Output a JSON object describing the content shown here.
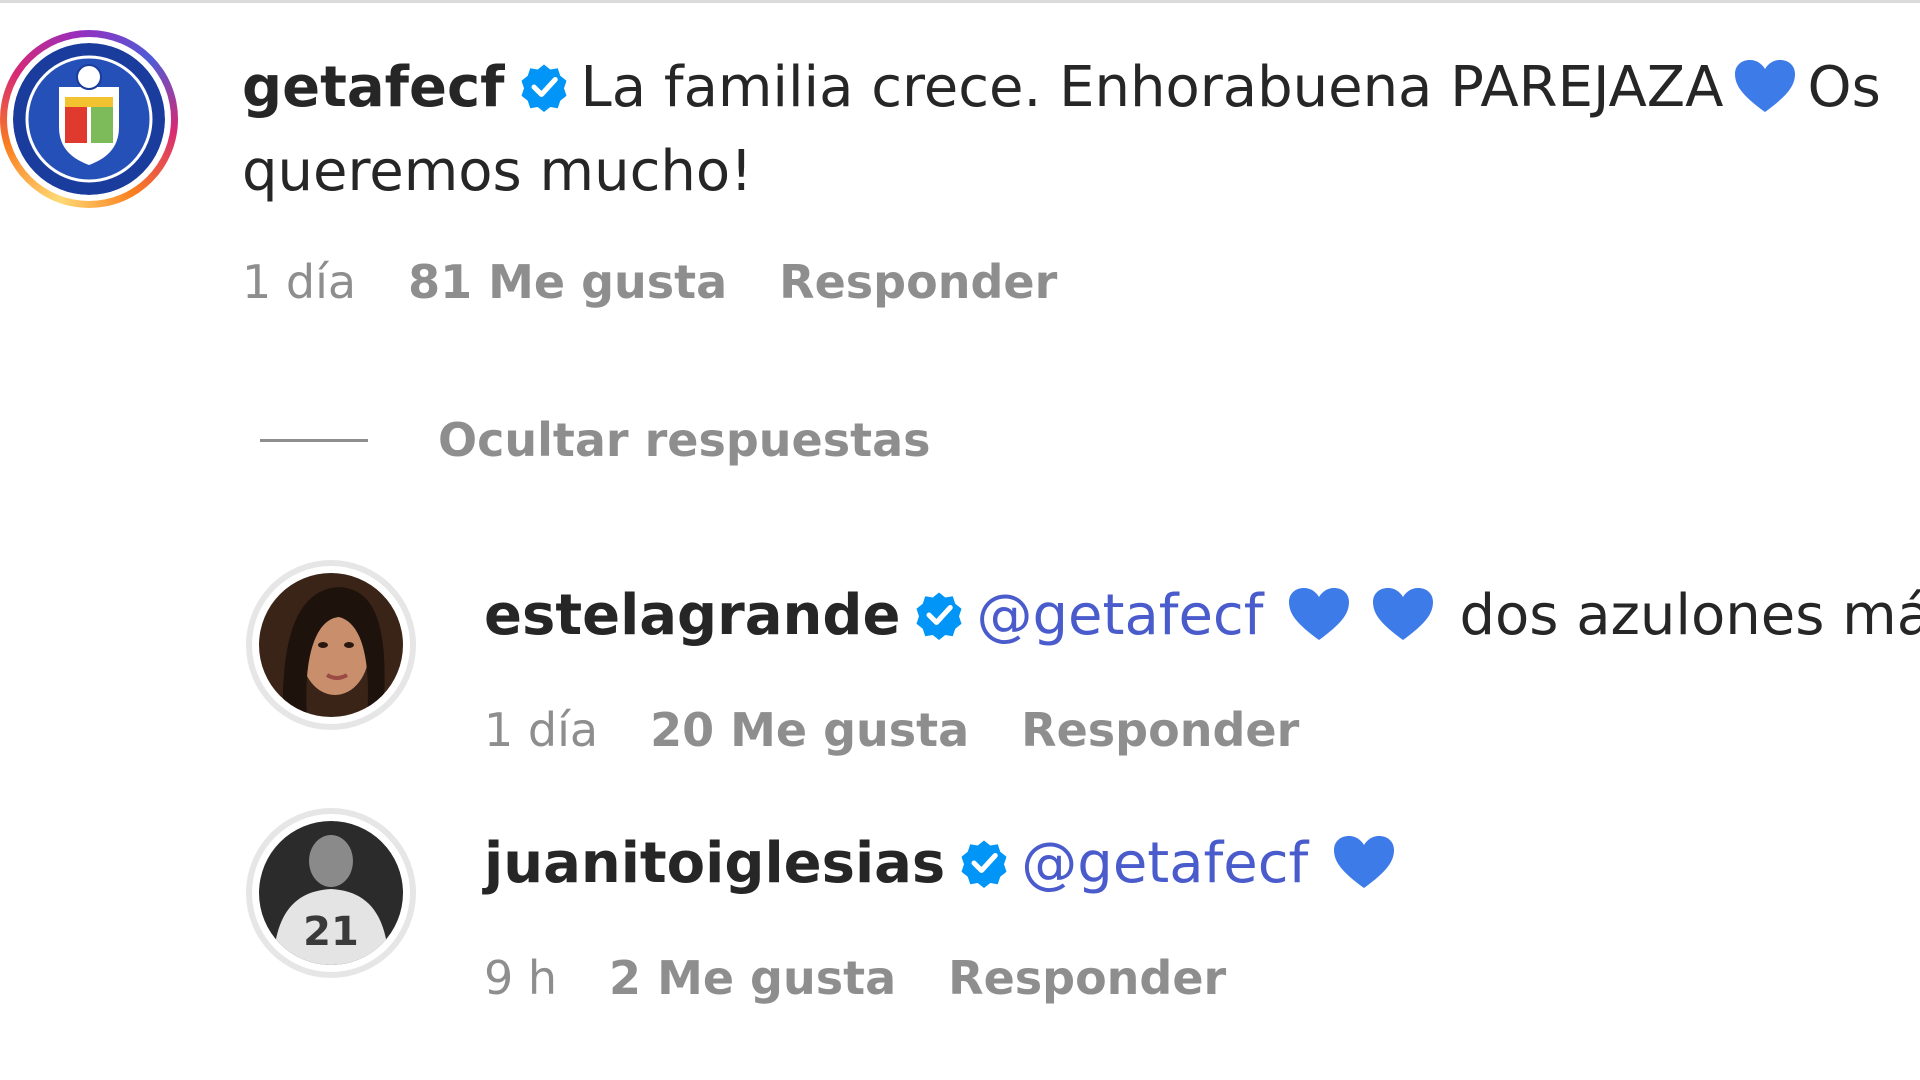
{
  "comments": [
    {
      "username": "getafecf",
      "verified": true,
      "text_line1_part1": "La familia crece. Enhorabuena PAREJAZA",
      "text_line1_part2": "Os",
      "text_line2": "queremos mucho!",
      "time": "1 día",
      "likes": "81 Me gusta",
      "reply": "Responder"
    },
    {
      "username": "estelagrande",
      "verified": true,
      "mention": "@getafecf",
      "text_after": "dos azulones más",
      "time": "1 día",
      "likes": "20 Me gusta",
      "reply": "Responder"
    },
    {
      "username": "juanitoiglesias",
      "verified": true,
      "mention": "@getafecf",
      "time": "9 h",
      "likes": "2 Me gusta",
      "reply": "Responder"
    }
  ],
  "replies_toggle": {
    "label": "Ocultar respuestas"
  },
  "icons": {
    "verified": "verified-badge-icon",
    "heart": "blue-heart-icon",
    "avatar_logo": "getafe-crest-icon"
  },
  "colors": {
    "verified_blue": "#0095f6",
    "heart_blue": "#3d7be8",
    "mention": "#4a5ccc",
    "secondary_text": "#8e8e8e"
  }
}
